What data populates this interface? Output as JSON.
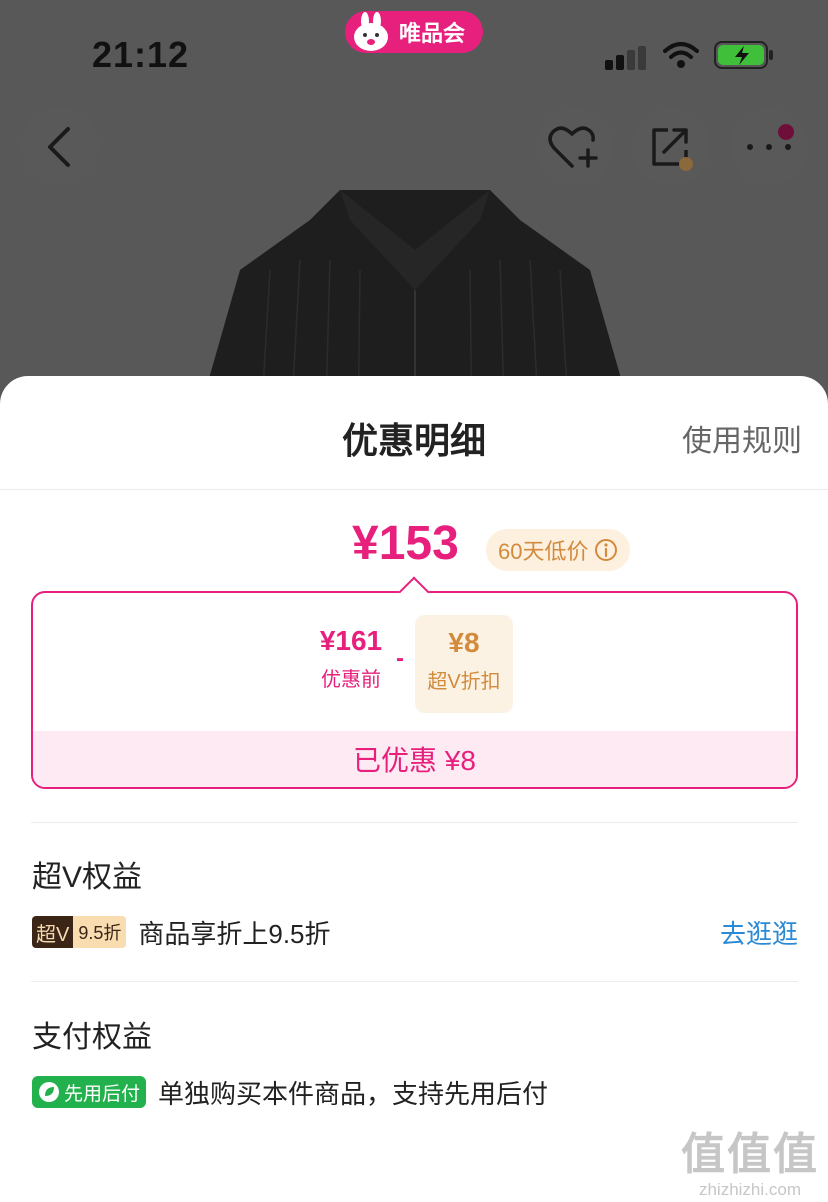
{
  "status_bar": {
    "time": "21:12",
    "app_badge": "唯品会"
  },
  "sheet": {
    "title": "优惠明细",
    "rules_link": "使用规则"
  },
  "price": {
    "final": "¥153",
    "low_badge": "60天低价"
  },
  "breakdown": {
    "original_amount": "¥161",
    "original_label": "优惠前",
    "minus": "-",
    "discount_amount": "¥8",
    "discount_label": "超V折扣",
    "saved": "已优惠 ¥8"
  },
  "svip_section": {
    "title": "超V权益",
    "tag_dark": "超V",
    "tag_light": "9.5折",
    "text": "商品享折上9.5折",
    "link": "去逛逛"
  },
  "pay_section": {
    "title": "支付权益",
    "tag": "先用后付",
    "text": "单独购买本件商品，支持先用后付"
  },
  "watermark": {
    "logo": "值值值",
    "url": "zhizhizhi.com"
  },
  "colors": {
    "accent": "#e6207c",
    "gold": "#d28b3c",
    "green": "#22b14c",
    "link": "#2b8ad6"
  },
  "icons": [
    "back-arrow-icon",
    "heart-plus-icon",
    "share-icon",
    "more-dots-icon",
    "info-icon",
    "wifi-icon",
    "battery-charging-icon",
    "signal-icon",
    "leaf-icon"
  ]
}
